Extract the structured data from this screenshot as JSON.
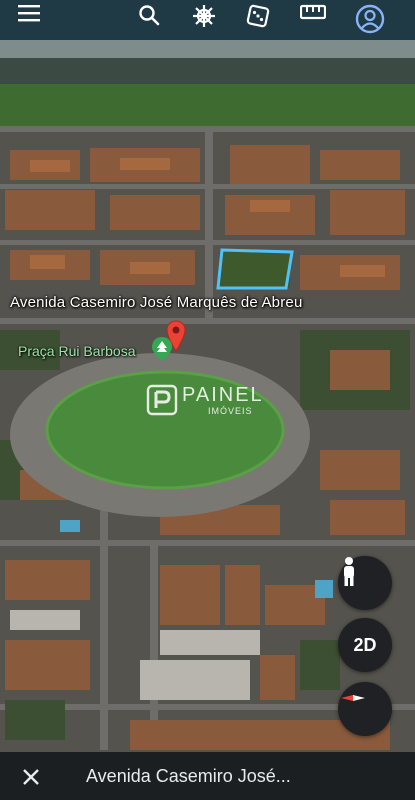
{
  "map": {
    "street_label": "Avenida Casemiro José Marquês de Abreu",
    "park_label": "Praça Rui Barbosa",
    "watermark_main": "PAINEL",
    "watermark_sub": "IMÓVEIS",
    "view_mode_label": "2D"
  },
  "toolbar": {
    "icons": [
      "menu-icon",
      "search-icon",
      "ship-wheel-icon",
      "dice-icon",
      "ruler-icon",
      "account-icon"
    ]
  },
  "bottom": {
    "title": "Avenida Casemiro José..."
  },
  "colors": {
    "toolbar_icon": "#ffffff",
    "account_accent": "#8ab4f8",
    "pin_red": "#ea4335",
    "park_green": "#34a853",
    "highlight": "#4fc3f7",
    "bottom_bar": "#1c1f22"
  }
}
